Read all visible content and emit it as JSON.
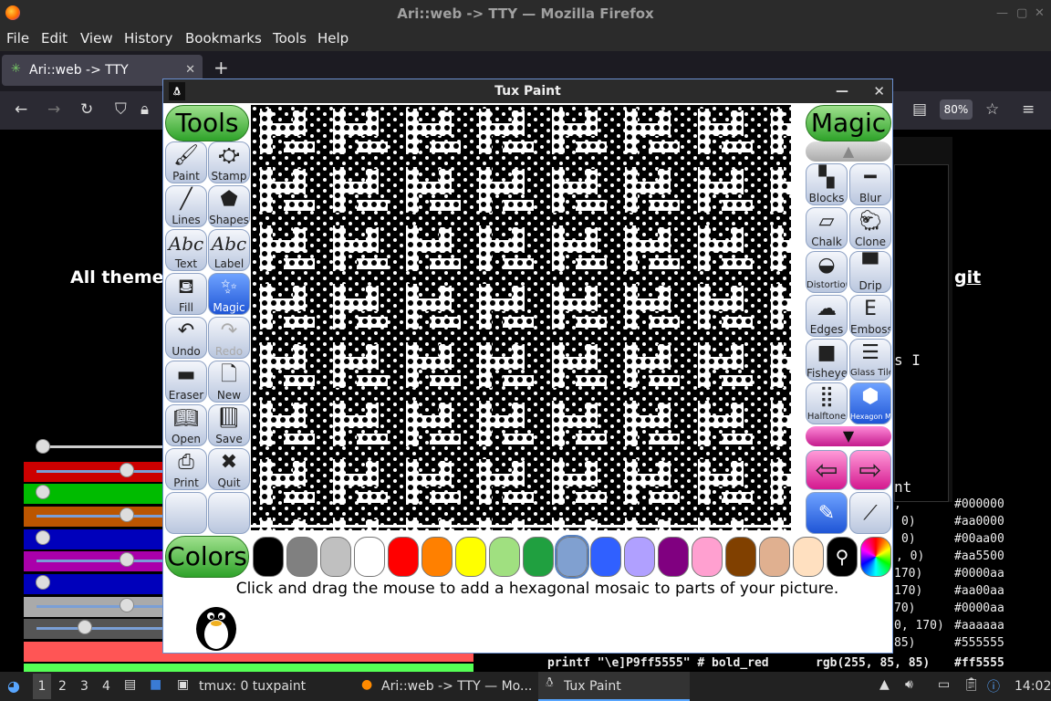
{
  "firefox": {
    "title": "Ari::web -> TTY — Mozilla Firefox",
    "menu": [
      "File",
      "Edit",
      "View",
      "History",
      "Bookmarks",
      "Tools",
      "Help"
    ],
    "tab_title": "Ari::web -> TTY",
    "zoom": "80%"
  },
  "page": {
    "heading_left": "All theme",
    "heading_right": "git",
    "terminal_lines": [
      {
        "col1": ",",
        "col2": "#000000"
      },
      {
        "col1": "0)",
        "col2": "#aa0000"
      },
      {
        "col1": "0)",
        "col2": "#00aa00"
      },
      {
        "col1": ", 0)",
        "col2": "#aa5500"
      },
      {
        "col1": "170)",
        "col2": "#0000aa"
      },
      {
        "col1": "170)",
        "col2": "#aa00aa"
      },
      {
        "col1": "70)",
        "col2": "#0000aa"
      },
      {
        "col1": "0, 170)",
        "col2": "#aaaaaa"
      },
      {
        "col1": "85)",
        "col2": "#555555"
      }
    ],
    "last_line": "printf \"\\e]P9ff5555\" # bold_red",
    "last_rgb": "rgb(255, 85, 85)",
    "last_hex": "#ff5555",
    "term_s": "s I",
    "term_nt": "nt"
  },
  "tuxpaint": {
    "title": "Tux Paint",
    "tools_header": "Tools",
    "magic_header": "Magic",
    "colors_header": "Colors",
    "tools": [
      "Paint",
      "Stamp",
      "Lines",
      "Shapes",
      "Text",
      "Label",
      "Fill",
      "Magic",
      "Undo",
      "Redo",
      "Eraser",
      "New",
      "Open",
      "Save",
      "Print",
      "Quit"
    ],
    "magic": [
      "Blocks",
      "Blur",
      "Chalk",
      "Clone",
      "Distortion",
      "Drip",
      "Edges",
      "Emboss",
      "Fisheye",
      "Glass Tile",
      "Halftone",
      "Hexagon Mosaic"
    ],
    "colors": [
      "#000000",
      "#808080",
      "#c0c0c0",
      "#ffffff",
      "#ff0000",
      "#ff8000",
      "#ffff00",
      "#a0e080",
      "#20a040",
      "#80a0d0",
      "#3060ff",
      "#b0a0ff",
      "#800080",
      "#ffa0d0",
      "#804000",
      "#e0b090",
      "#ffe0c0"
    ],
    "tip": "Click and drag the mouse to add a hexagonal mosaic to parts of your picture."
  },
  "taskbar": {
    "workspaces": [
      "1",
      "2",
      "3",
      "4"
    ],
    "tasks": [
      "tmux: 0 tuxpaint",
      "Ari::web -> TTY — Mo...",
      "Tux Paint"
    ],
    "clock": "14:02"
  }
}
